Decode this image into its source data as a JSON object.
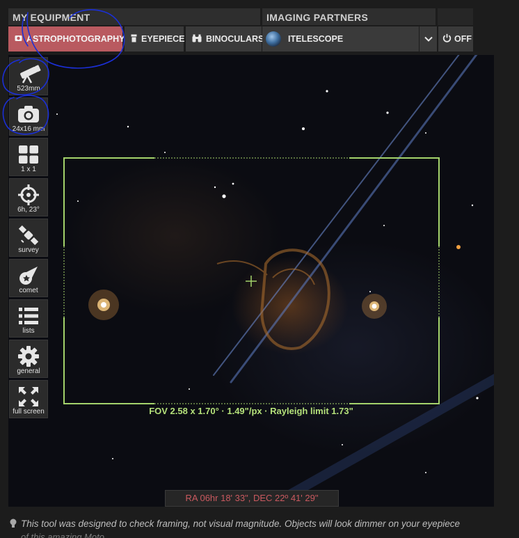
{
  "headers": {
    "my_equipment": "MY EQUIPMENT",
    "imaging_partners": "IMAGING PARTNERS"
  },
  "tabs": {
    "astrophotography": "ASTROPHOTOGRAPHY",
    "eyepiece": "EYEPIECE",
    "binoculars": "BINOCULARS",
    "itelescope": "ITELESCOPE",
    "off": "OFF"
  },
  "tools": [
    {
      "icon": "telescope-icon",
      "label": "523mm"
    },
    {
      "icon": "camera-icon",
      "label": "24x16 mm"
    },
    {
      "icon": "grid-icon",
      "label": "1 x 1"
    },
    {
      "icon": "crosshair-icon",
      "label": "6h, 23°"
    },
    {
      "icon": "satellite-icon",
      "label": "survey"
    },
    {
      "icon": "comet-icon",
      "label": "comet"
    },
    {
      "icon": "list-icon",
      "label": "lists"
    },
    {
      "icon": "gear-icon",
      "label": "general"
    },
    {
      "icon": "fullscreen-icon",
      "label": "full screen"
    }
  ],
  "fov_label": "FOV 2.58 x 1.70° · 1.49\"/px · Rayleigh limit 1.73\"",
  "radec": "RA 06hr 18' 33\", DEC 22º 41' 29\"",
  "footer_note": "This tool was designed to check framing, not visual magnitude. Objects will look dimmer on your eyepiece",
  "footer_note_2": "of this amazing Moto",
  "colors": {
    "active_tab": "#b95a60",
    "fov_frame": "#a4d36b",
    "radec_text": "#c9595f",
    "annotation_ink": "#1b2fd6"
  }
}
